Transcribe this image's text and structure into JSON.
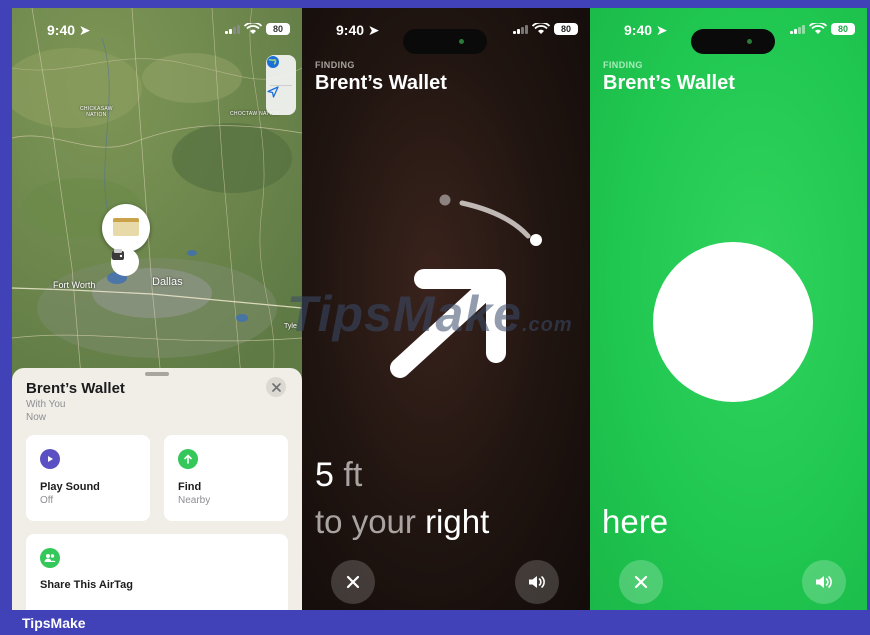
{
  "status": {
    "time": "9:40",
    "battery": "80"
  },
  "map": {
    "labels": {
      "chickasaw": "CHICKASAW\nNATION",
      "choctaw": "CHOCTAW NATION",
      "fort_worth": "Fort Worth",
      "dallas": "Dallas",
      "tyler": "Tyle"
    },
    "controls": {
      "globe": "globe-icon",
      "location": "location-arrow-icon"
    }
  },
  "sheet": {
    "title": "Brent’s Wallet",
    "subtitle": "With You",
    "time": "Now",
    "cards": {
      "play_sound": {
        "title": "Play Sound",
        "sub": "Off",
        "color": "#5b4fc4"
      },
      "find": {
        "title": "Find",
        "sub": "Nearby",
        "color": "#34c759"
      },
      "share": {
        "title": "Share This AirTag",
        "color": "#34c759"
      }
    }
  },
  "finding": {
    "label": "FINDING",
    "name": "Brent’s Wallet",
    "distance_value": "5",
    "distance_unit": " ft",
    "direction_prefix": "to your ",
    "direction": "right",
    "here": "here"
  },
  "colors": {
    "dark_bg": "#1a0f0c",
    "green_bg": "#1fc64f",
    "frame": "#4242b8"
  },
  "watermark": {
    "text": "TipsMake",
    "suffix": ".com"
  },
  "footer": {
    "brand": "TipsMake"
  }
}
